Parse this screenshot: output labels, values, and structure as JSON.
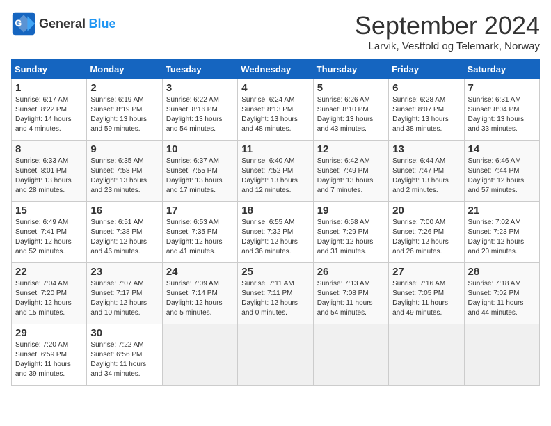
{
  "header": {
    "logo_general": "General",
    "logo_blue": "Blue",
    "title": "September 2024",
    "subtitle": "Larvik, Vestfold og Telemark, Norway"
  },
  "days_of_week": [
    "Sunday",
    "Monday",
    "Tuesday",
    "Wednesday",
    "Thursday",
    "Friday",
    "Saturday"
  ],
  "weeks": [
    [
      {
        "day": "1",
        "info": "Sunrise: 6:17 AM\nSunset: 8:22 PM\nDaylight: 14 hours\nand 4 minutes."
      },
      {
        "day": "2",
        "info": "Sunrise: 6:19 AM\nSunset: 8:19 PM\nDaylight: 13 hours\nand 59 minutes."
      },
      {
        "day": "3",
        "info": "Sunrise: 6:22 AM\nSunset: 8:16 PM\nDaylight: 13 hours\nand 54 minutes."
      },
      {
        "day": "4",
        "info": "Sunrise: 6:24 AM\nSunset: 8:13 PM\nDaylight: 13 hours\nand 48 minutes."
      },
      {
        "day": "5",
        "info": "Sunrise: 6:26 AM\nSunset: 8:10 PM\nDaylight: 13 hours\nand 43 minutes."
      },
      {
        "day": "6",
        "info": "Sunrise: 6:28 AM\nSunset: 8:07 PM\nDaylight: 13 hours\nand 38 minutes."
      },
      {
        "day": "7",
        "info": "Sunrise: 6:31 AM\nSunset: 8:04 PM\nDaylight: 13 hours\nand 33 minutes."
      }
    ],
    [
      {
        "day": "8",
        "info": "Sunrise: 6:33 AM\nSunset: 8:01 PM\nDaylight: 13 hours\nand 28 minutes."
      },
      {
        "day": "9",
        "info": "Sunrise: 6:35 AM\nSunset: 7:58 PM\nDaylight: 13 hours\nand 23 minutes."
      },
      {
        "day": "10",
        "info": "Sunrise: 6:37 AM\nSunset: 7:55 PM\nDaylight: 13 hours\nand 17 minutes."
      },
      {
        "day": "11",
        "info": "Sunrise: 6:40 AM\nSunset: 7:52 PM\nDaylight: 13 hours\nand 12 minutes."
      },
      {
        "day": "12",
        "info": "Sunrise: 6:42 AM\nSunset: 7:49 PM\nDaylight: 13 hours\nand 7 minutes."
      },
      {
        "day": "13",
        "info": "Sunrise: 6:44 AM\nSunset: 7:47 PM\nDaylight: 13 hours\nand 2 minutes."
      },
      {
        "day": "14",
        "info": "Sunrise: 6:46 AM\nSunset: 7:44 PM\nDaylight: 12 hours\nand 57 minutes."
      }
    ],
    [
      {
        "day": "15",
        "info": "Sunrise: 6:49 AM\nSunset: 7:41 PM\nDaylight: 12 hours\nand 52 minutes."
      },
      {
        "day": "16",
        "info": "Sunrise: 6:51 AM\nSunset: 7:38 PM\nDaylight: 12 hours\nand 46 minutes."
      },
      {
        "day": "17",
        "info": "Sunrise: 6:53 AM\nSunset: 7:35 PM\nDaylight: 12 hours\nand 41 minutes."
      },
      {
        "day": "18",
        "info": "Sunrise: 6:55 AM\nSunset: 7:32 PM\nDaylight: 12 hours\nand 36 minutes."
      },
      {
        "day": "19",
        "info": "Sunrise: 6:58 AM\nSunset: 7:29 PM\nDaylight: 12 hours\nand 31 minutes."
      },
      {
        "day": "20",
        "info": "Sunrise: 7:00 AM\nSunset: 7:26 PM\nDaylight: 12 hours\nand 26 minutes."
      },
      {
        "day": "21",
        "info": "Sunrise: 7:02 AM\nSunset: 7:23 PM\nDaylight: 12 hours\nand 20 minutes."
      }
    ],
    [
      {
        "day": "22",
        "info": "Sunrise: 7:04 AM\nSunset: 7:20 PM\nDaylight: 12 hours\nand 15 minutes."
      },
      {
        "day": "23",
        "info": "Sunrise: 7:07 AM\nSunset: 7:17 PM\nDaylight: 12 hours\nand 10 minutes."
      },
      {
        "day": "24",
        "info": "Sunrise: 7:09 AM\nSunset: 7:14 PM\nDaylight: 12 hours\nand 5 minutes."
      },
      {
        "day": "25",
        "info": "Sunrise: 7:11 AM\nSunset: 7:11 PM\nDaylight: 12 hours\nand 0 minutes."
      },
      {
        "day": "26",
        "info": "Sunrise: 7:13 AM\nSunset: 7:08 PM\nDaylight: 11 hours\nand 54 minutes."
      },
      {
        "day": "27",
        "info": "Sunrise: 7:16 AM\nSunset: 7:05 PM\nDaylight: 11 hours\nand 49 minutes."
      },
      {
        "day": "28",
        "info": "Sunrise: 7:18 AM\nSunset: 7:02 PM\nDaylight: 11 hours\nand 44 minutes."
      }
    ],
    [
      {
        "day": "29",
        "info": "Sunrise: 7:20 AM\nSunset: 6:59 PM\nDaylight: 11 hours\nand 39 minutes."
      },
      {
        "day": "30",
        "info": "Sunrise: 7:22 AM\nSunset: 6:56 PM\nDaylight: 11 hours\nand 34 minutes."
      },
      {
        "day": "",
        "info": ""
      },
      {
        "day": "",
        "info": ""
      },
      {
        "day": "",
        "info": ""
      },
      {
        "day": "",
        "info": ""
      },
      {
        "day": "",
        "info": ""
      }
    ]
  ]
}
